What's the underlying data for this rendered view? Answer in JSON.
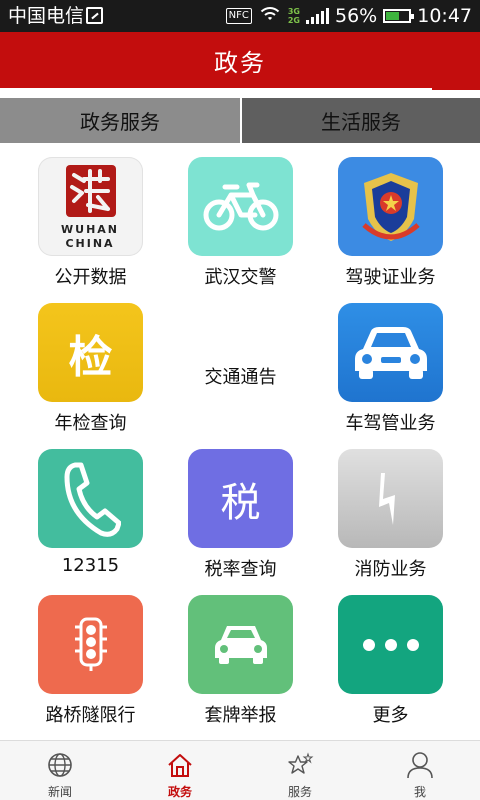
{
  "status_bar": {
    "carrier": "中国电信",
    "nfc": "NFC",
    "net_top": "3G",
    "net_bottom": "2G",
    "battery": "56%",
    "battery_level": 0.56,
    "time": "10:47"
  },
  "header": {
    "title": "政务"
  },
  "tabs": [
    {
      "label": "政务服务",
      "selected": true
    },
    {
      "label": "生活服务",
      "selected": false
    }
  ],
  "grid": [
    {
      "label": "公开数据",
      "icon": "wuhan-china-logo-icon",
      "logo_text": "WUHAN CHINA"
    },
    {
      "label": "武汉交警",
      "icon": "bicycle-icon",
      "color": "#7ee3d2"
    },
    {
      "label": "驾驶证业务",
      "icon": "police-emblem-icon",
      "color": "#3c8be3"
    },
    {
      "label": "年检查询",
      "icon": "inspection-icon",
      "glyph": "检",
      "color": "#f0c21c"
    },
    {
      "label": "交通通告",
      "icon": "none"
    },
    {
      "label": "车驾管业务",
      "icon": "car-icon",
      "color": "#2a84de"
    },
    {
      "label": "12315",
      "icon": "phone-icon",
      "color": "#43bd9e"
    },
    {
      "label": "税率查询",
      "icon": "tax-icon",
      "glyph": "税",
      "color": "#6f6ee3"
    },
    {
      "label": "消防业务",
      "icon": "lightning-icon",
      "color": "#c8c8c8"
    },
    {
      "label": "路桥隧限行",
      "icon": "traffic-light-icon",
      "color": "#ee6a4e"
    },
    {
      "label": "套牌举报",
      "icon": "car-front-icon",
      "color": "#62c07a"
    },
    {
      "label": "更多",
      "icon": "more-dots-icon",
      "color": "#13a57f"
    }
  ],
  "bottom_nav": [
    {
      "label": "新闻",
      "icon": "globe-icon",
      "active": false
    },
    {
      "label": "政务",
      "icon": "home-icon",
      "active": true
    },
    {
      "label": "服务",
      "icon": "stars-icon",
      "active": false
    },
    {
      "label": "我",
      "icon": "user-icon",
      "active": false
    }
  ],
  "colors": {
    "brand_red": "#c30d0d"
  }
}
